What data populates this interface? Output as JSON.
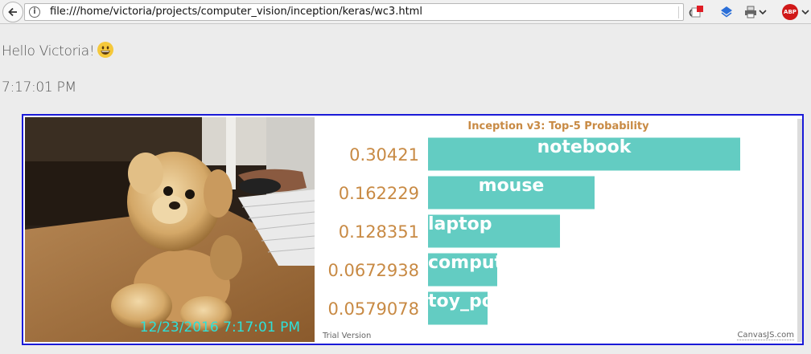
{
  "browser": {
    "url": "file:///home/victoria/projects/computer_vision/inception/keras/wc3.html",
    "info_icon_label": "i",
    "abp_label": "ABP"
  },
  "page": {
    "greeting": "Hello Victoria!",
    "time": "7:17:01 PM"
  },
  "webcam": {
    "timestamp": "12/23/2016  7:17:01 PM"
  },
  "chart_data": {
    "type": "bar",
    "title": "Inception v3: Top-5 Probability",
    "categories": [
      "notebook",
      "mouse",
      "laptop",
      "computer",
      "toy_poodle"
    ],
    "values": [
      0.30421,
      0.162229,
      0.128351,
      0.0672938,
      0.0579078
    ],
    "value_labels": [
      "0.30421",
      "0.162229",
      "0.128351",
      "0.0672938",
      "0.0579078"
    ],
    "bar_color": "#63ccc2",
    "label_color": "#c88a44",
    "orientation": "horizontal"
  },
  "footer": {
    "trial": "Trial Version",
    "credit": "CanvasJS.com"
  },
  "colors": {
    "frame_border": "#1a1ad8",
    "timestamp": "#2ee0d8"
  }
}
